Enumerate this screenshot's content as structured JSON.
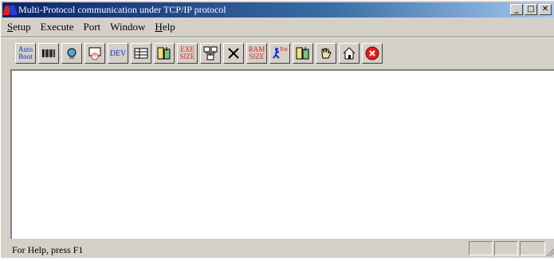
{
  "window": {
    "title": "Multi-Protocol communication under TCP/IP protocol",
    "caption_buttons": [
      "_",
      "□",
      "✕"
    ]
  },
  "menu": {
    "items": [
      {
        "first": "S",
        "rest": "etup"
      },
      {
        "first": "",
        "rest": "Execute"
      },
      {
        "first": "",
        "rest": "Port"
      },
      {
        "first": "",
        "rest": "Window"
      },
      {
        "first": "H",
        "rest": "elp"
      }
    ]
  },
  "toolbar": {
    "auto_boot_line1": "Auto",
    "auto_boot_line2": "Boot",
    "dev_label": "DEV",
    "exe_size_line1": "EXE",
    "exe_size_line2": "SIZE",
    "ram_size_line1": "RAM",
    "ram_size_line2": "SIZE",
    "run_label": "Run",
    "icons": [
      "auto-boot",
      "barcode",
      "monitor",
      "clock",
      "dev",
      "table",
      "transfer",
      "exe-size",
      "network",
      "delete",
      "ram-size",
      "run",
      "transfer",
      "hand",
      "home",
      "stop"
    ]
  },
  "status": {
    "help_text": "For Help, press F1"
  },
  "colors": {
    "face": "#d4d0c8",
    "title_start": "#0a246a",
    "title_end": "#a6caf0",
    "accent_blue": "#1030d0",
    "accent_red": "#e02020"
  }
}
